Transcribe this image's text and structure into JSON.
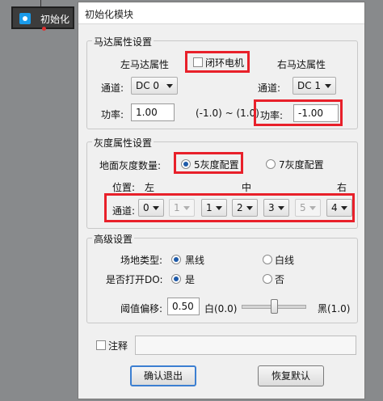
{
  "canvas_node": {
    "label": "初始化"
  },
  "dialog": {
    "title": "初始化模块",
    "motor": {
      "group_title": "马达属性设置",
      "left_title": "左马达属性",
      "closed_loop_label": "闭环电机",
      "right_title": "右马达属性",
      "channel_label": "通道:",
      "left_channel": "DC 0",
      "right_channel": "DC 1",
      "power_label": "功率:",
      "left_power": "1.00",
      "range_text": "(-1.0) ~ (1.0)",
      "right_power": "-1.00"
    },
    "gray": {
      "group_title": "灰度属性设置",
      "count_label": "地面灰度数量:",
      "opt5": "5灰度配置",
      "opt7": "7灰度配置",
      "position_label": "位置:",
      "pos_left": "左",
      "pos_mid": "中",
      "pos_right": "右",
      "channel_label": "通道:",
      "channels": [
        "0",
        "1",
        "1",
        "2",
        "3",
        "5",
        "4"
      ]
    },
    "advanced": {
      "group_title": "高级设置",
      "field_type_label": "场地类型:",
      "black_line": "黑线",
      "white_line": "白线",
      "do_label": "是否打开DO:",
      "yes": "是",
      "no": "否",
      "threshold_label": "阈值偏移:",
      "threshold_value": "0.50",
      "slider_min_label": "白(0.0)",
      "slider_max_label": "黑(1.0)",
      "slider_value": 0.5
    },
    "comment_label": "注释",
    "comment_value": "",
    "ok_button": "确认退出",
    "reset_button": "恢复默认"
  },
  "colors": {
    "highlight": "#e8202a",
    "node_icon": "#1a9bea",
    "default_button_border": "#3c7fd1"
  }
}
